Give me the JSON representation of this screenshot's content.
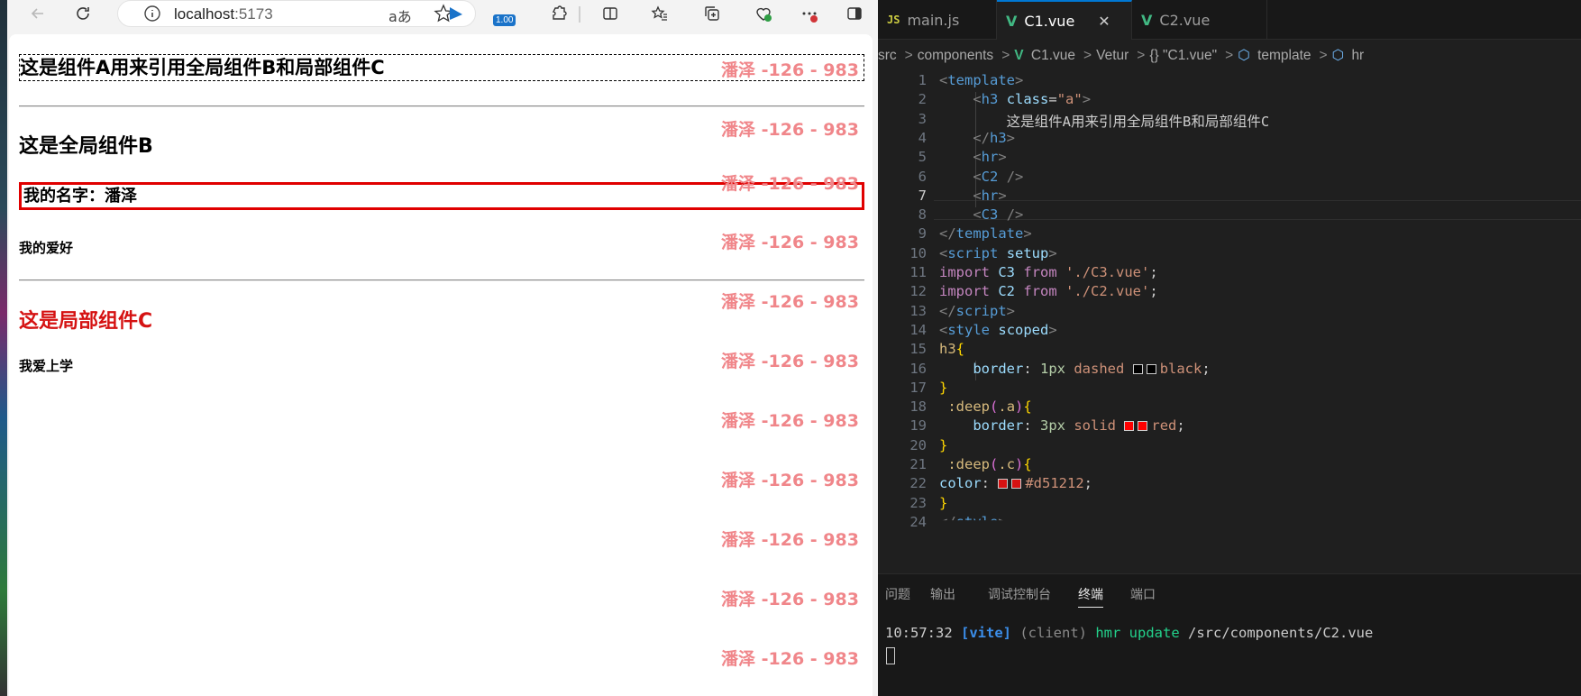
{
  "browser": {
    "url_host": "localhost",
    "url_port": ":5173",
    "read_aloud_glyph": "aあ",
    "zoom_badge": "1.00",
    "page": {
      "heading_a": "这是组件A用来引用全局组件B和局部组件C",
      "heading_b": "这是全局组件B",
      "name_line": "我的名字：潘泽",
      "hobby_title": "我的爱好",
      "heading_c": "这是局部组件C",
      "c_text": "我爱上学",
      "watermark": "潘泽 -126 - 983",
      "heading_c_color": "#d51212",
      "name_border_color": "#e00000"
    }
  },
  "vscode": {
    "tabs": [
      {
        "badge": "JS",
        "label": "main.js"
      },
      {
        "badge": "V",
        "label": "C1.vue",
        "close": "✕"
      },
      {
        "badge": "V",
        "label": "C2.vue"
      }
    ],
    "breadcrumb": {
      "src": "src",
      "components": "components",
      "file": "C1.vue",
      "vetur": "Vetur",
      "block": "{} \"C1.vue\"",
      "template": "template",
      "hr": "hr",
      "sep": ">"
    },
    "line_numbers": [
      "1",
      "2",
      "3",
      "4",
      "5",
      "6",
      "7",
      "8",
      "9",
      "10",
      "11",
      "12",
      "13",
      "14",
      "15",
      "16",
      "17",
      "18",
      "19",
      "20",
      "21",
      "22",
      "23",
      "24"
    ],
    "code": {
      "l3_text": "这是组件A用来引用全局组件B和局部组件C",
      "l11_path": "'./C3.vue'",
      "l12_path": "'./C2.vue'",
      "l16_value": "black",
      "l19_value": "red",
      "l22_value": "#d51212"
    },
    "panel": {
      "tabs": [
        "问题",
        "输出",
        "调试控制台",
        "终端",
        "端口"
      ],
      "active_tab": "终端",
      "terminal": {
        "time": "10:57:32",
        "tag": "[vite]",
        "client": "(client)",
        "action": "hmr update",
        "path": "/src/components/C2.vue"
      }
    }
  }
}
